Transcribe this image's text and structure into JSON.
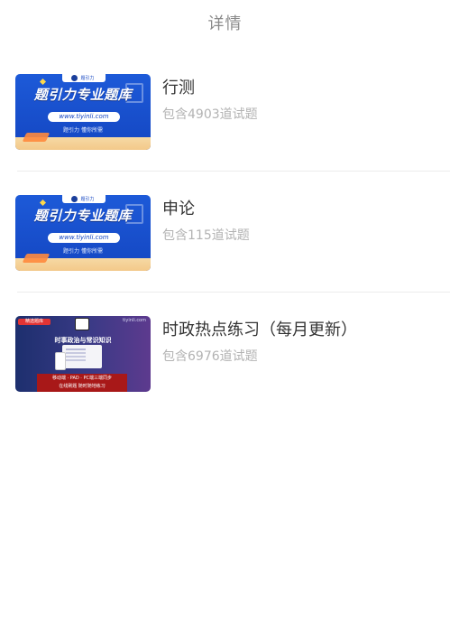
{
  "header": {
    "title": "详情"
  },
  "items": [
    {
      "title": "行测",
      "subtitle": "包含4903道试题",
      "thumb": {
        "brand": "题引力",
        "headline": "题引力专业题库",
        "url": "www.tiyinli.com",
        "slogan": "题引力 懂你所需"
      }
    },
    {
      "title": "申论",
      "subtitle": "包含115道试题",
      "thumb": {
        "brand": "题引力",
        "headline": "题引力专业题库",
        "url": "www.tiyinli.com",
        "slogan": "题引力 懂你所需"
      }
    },
    {
      "title": "时政热点练习（每月更新）",
      "subtitle": "包含6976道试题",
      "thumb": {
        "tag": "精选题库",
        "site": "tiyinli.com",
        "caption": "时事政治与常识知识",
        "bar_line1": "移动端 · PAD · PC端三端同步",
        "bar_line2": "在线刷题 随时随地练习"
      }
    }
  ]
}
